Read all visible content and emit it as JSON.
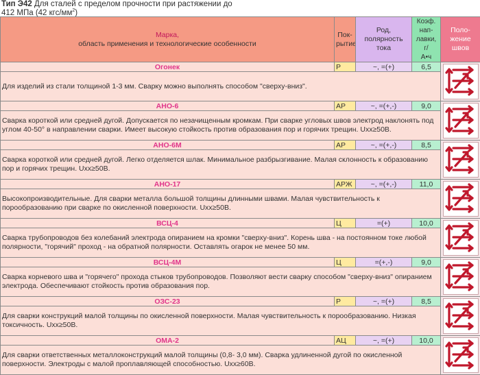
{
  "header": {
    "type_label": "Тип Э42",
    "line1": "Для сталей с пределом прочности при растяжении до",
    "line2": "412 МПа (42 кгс/мм",
    "line2_sup": "2",
    "line2_end": ")"
  },
  "columns": {
    "mark": "Марка,",
    "mark_sub": "область применения и технологические особенности",
    "cover1": "Пок-",
    "cover2": "рытие",
    "polarity1": "Род, полярность",
    "polarity2": "тока",
    "coef1": "Коэф.",
    "coef2": "нап-",
    "coef3": "лавки, г/",
    "coef4": "А•ч",
    "position1": "Поло-",
    "position2": "жение швов"
  },
  "rows": [
    {
      "name": "Огонек",
      "cover": "Р",
      "polarity": "~, =(+)",
      "coef": "6,5",
      "desc": "Для изделий из стали толщиной 1-3 мм. Сварку можно выполнять способом \"сверху-вниз\".",
      "icon": "weld-positions-icon"
    },
    {
      "name": "АНО-6",
      "cover": "АР",
      "polarity": "~, =(+,-)",
      "coef": "9,0",
      "desc": "Сварка короткой или средней дугой. Допускается по незачищенным кромкам. При сварке угловых швов электрод наклонять под углом 40-50° в направлении сварки. Имеет высокую стойкость против образования пор и горячих трещин. Uxx≥50В.",
      "icon": "weld-positions-icon"
    },
    {
      "name": "АНО-6М",
      "cover": "АР",
      "polarity": "~, =(+,-)",
      "coef": "8,5",
      "desc": "Сварка короткой или средней дугой. Легко отделяется шлак. Минимальное разбрызгивание. Малая склонность к образованию пор и горячих трещин. Uxx≥50В.",
      "icon": "weld-positions-icon"
    },
    {
      "name": "АНО-17",
      "cover": "АРЖ",
      "polarity": "~, =(+,-)",
      "coef": "11,0",
      "desc": "Высокопроизводительные. Для сварки металла большой толщины длинными швами. Малая чувствительность к порообразованию при сварке по окисленной поверхности. Uxx≥50В.",
      "icon": "weld-positions-icon"
    },
    {
      "name": "ВСЦ-4",
      "cover": "Ц",
      "polarity": "=(+)",
      "coef": "10,0",
      "desc": "Сварка трубопроводов без колебаний электрода опиранием на кромки \"сверху-вниз\". Корень шва - на постоянном токе любой полярности, \"горячий\" проход - на обратной полярности. Оставлять огарок не менее 50 мм.",
      "icon": "weld-positions-icon"
    },
    {
      "name": "ВСЦ-4М",
      "cover": "Ц",
      "polarity": "=(+,-)",
      "coef": "9,0",
      "desc": "Сварка корневого шва и \"горячего\" прохода стыков трубопроводов. Позволяют вести сварку способом \"сверху-вниз\" опиранием электрода. Обеспечивают стойкость против образования пор.",
      "icon": "weld-positions-icon"
    },
    {
      "name": "ОЗС-23",
      "cover": "Р",
      "polarity": "~, =(+)",
      "coef": "8,5",
      "desc": "Для сварки конструкций малой толщины по окисленной поверхности. Малая чувствительность к порообразованию. Низкая токсичность. Uxx≥50В.",
      "icon": "weld-positions-icon"
    },
    {
      "name": "ОМА-2",
      "cover": "АЦ",
      "polarity": "~, =(+)",
      "coef": "10,0",
      "desc": "Для сварки ответственных металлоконструкций малой толщины (0,8- 3,0 мм). Сварка удлиненной дугой по окисленной поверхности. Электроды с малой проплавляющей способностью. Uxx≥60В.",
      "icon": "weld-positions-icon"
    }
  ],
  "colors": {
    "header_mark": "#f59a84",
    "polarity_bg": "#d9b6ee",
    "coef_bg": "#8fe3b0",
    "position_bg": "#ee7a8f",
    "arrow": "#c0182c",
    "row_bg": "#fcdfd8",
    "cover_bg": "#ffeaa0"
  }
}
